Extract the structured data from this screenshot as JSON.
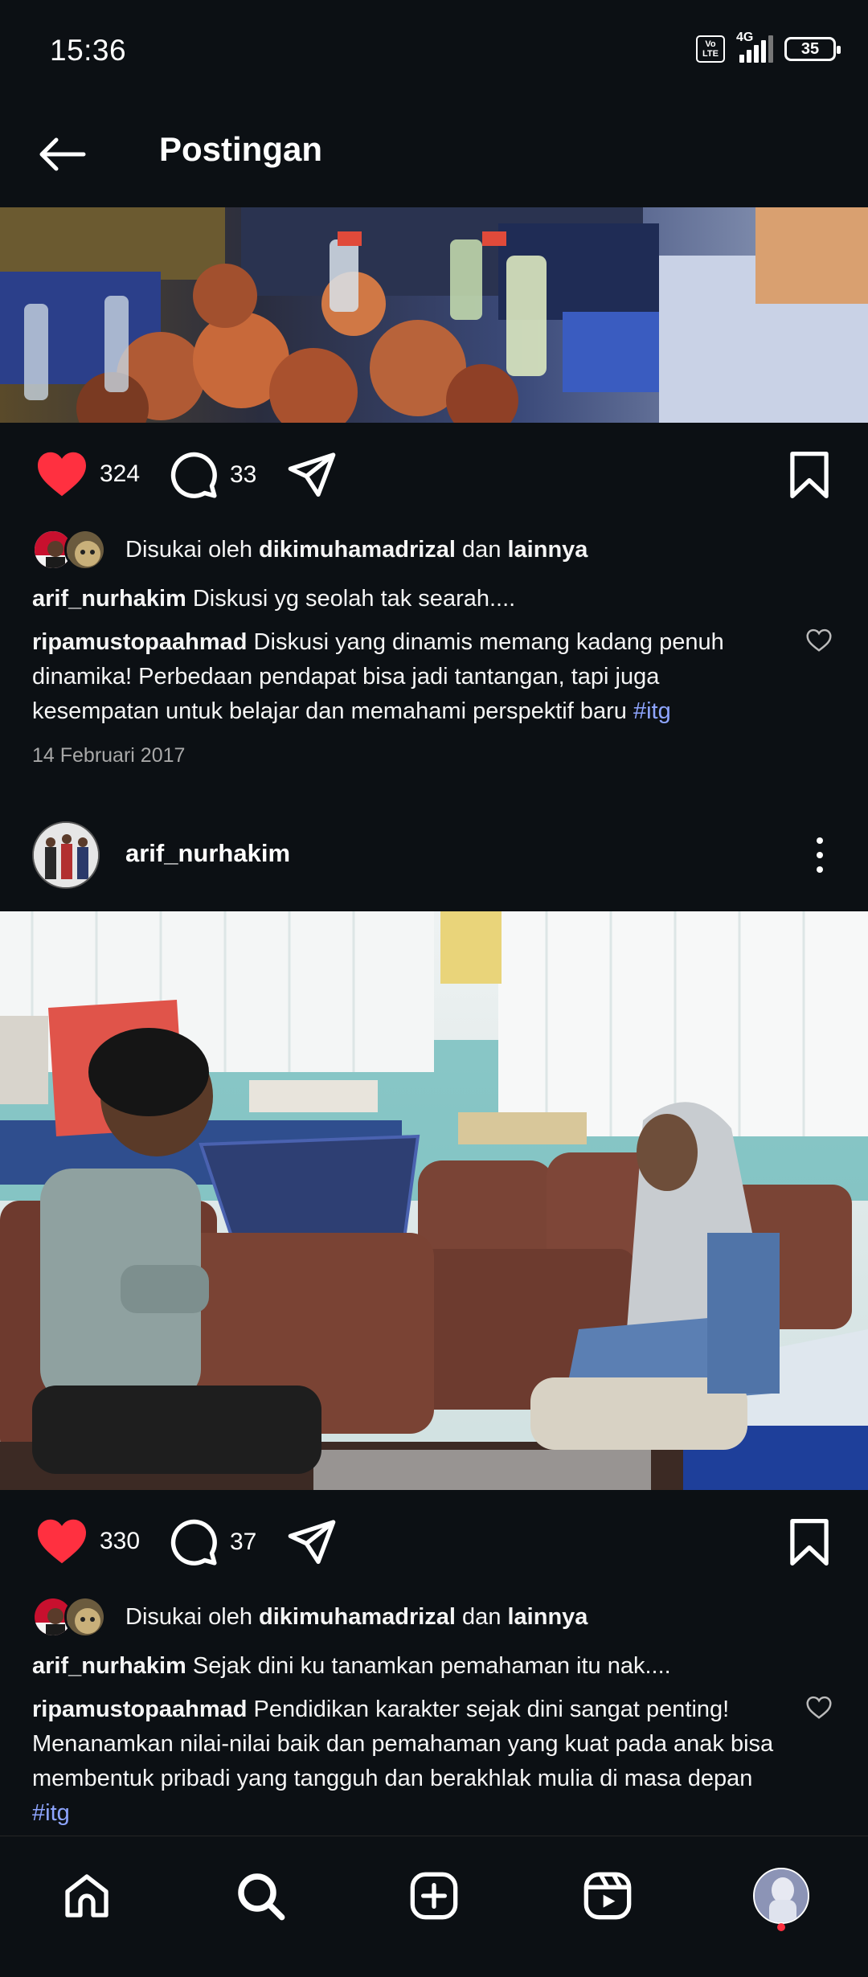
{
  "status_bar": {
    "time": "15:36",
    "volte": "Vo LTE",
    "network": "4G",
    "battery": "35"
  },
  "header": {
    "title": "Postingan",
    "back_icon": "arrow-left-icon"
  },
  "post1": {
    "likes": "324",
    "comments": "33",
    "liked_by_prefix": "Disukai oleh ",
    "liked_by_user": "dikimuhamadrizal",
    "liked_by_and": " dan ",
    "liked_by_others": "lainnya",
    "caption_user": "arif_nurhakim",
    "caption_text": " Diskusi yg seolah tak searah....",
    "comment_user": "ripamustopaahmad",
    "comment_text": " Diskusi yang dinamis memang kadang penuh dinamika! Perbedaan pendapat bisa jadi tantangan, tapi juga kesempatan untuk belajar dan memahami perspektif baru ",
    "comment_hashtag": "#itg",
    "date": "14 Februari 2017"
  },
  "post2": {
    "username": "arif_nurhakim",
    "likes": "330",
    "comments": "37",
    "liked_by_prefix": "Disukai oleh ",
    "liked_by_user": "dikimuhamadrizal",
    "liked_by_and": " dan ",
    "liked_by_others": "lainnya",
    "caption_user": "arif_nurhakim",
    "caption_text": " Sejak dini ku tanamkan pemahaman itu nak....",
    "comment_user": "ripamustopaahmad",
    "comment_text": " Pendidikan karakter sejak dini sangat penting! Menanamkan nilai-nilai baik dan pemahaman yang kuat pada anak bisa membentuk pribadi yang tangguh dan berakhlak mulia di masa depan ",
    "comment_hashtag": "#itg"
  },
  "bottom_nav": [
    "home-icon",
    "search-icon",
    "create-icon",
    "reels-icon",
    "profile-avatar"
  ],
  "colors": {
    "background": "#0c1014",
    "like_red": "#ff3040",
    "hashtag": "#8ea5ff",
    "muted": "#a8a8a8"
  }
}
